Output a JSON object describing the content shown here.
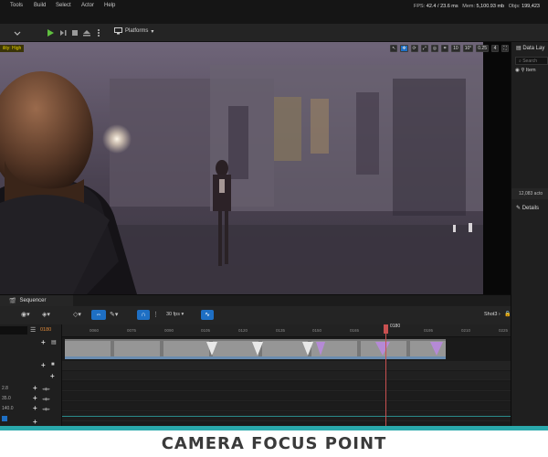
{
  "menu": [
    "Tools",
    "Build",
    "Select",
    "Actor",
    "Help"
  ],
  "stats": {
    "fps_label": "FPS:",
    "fps_value": "42.4",
    "ms_value": "/ 23.6 ms",
    "mem_label": "Mem:",
    "mem_value": "5,100.93 mb",
    "objs_label": "Objs:",
    "objs_value": "199,423"
  },
  "toolbar": {
    "platforms_label": "Platforms"
  },
  "viewport": {
    "quality_badge": "ility: High",
    "tool_values": [
      "10",
      "10°",
      "0.25",
      "4"
    ]
  },
  "right_panel": {
    "data_layers_tab": "Data Lay",
    "search_placeholder": "Search",
    "item_label": "Item",
    "actor_count": "12,083 acto",
    "details_tab": "Details"
  },
  "sequencer": {
    "tab_label": "Sequencer",
    "fps_label": "30 fps",
    "shot_label": "Shot3",
    "frame_current": "0180",
    "playhead_label": "0180",
    "ticks": [
      "0060",
      "0075",
      "0090",
      "0105",
      "0120",
      "0135",
      "0150",
      "0165",
      "0195",
      "0210",
      "0225"
    ],
    "left_values": [
      "2.8",
      "35.0",
      "140.0"
    ]
  },
  "caption": "CAMERA FOCUS POINT"
}
